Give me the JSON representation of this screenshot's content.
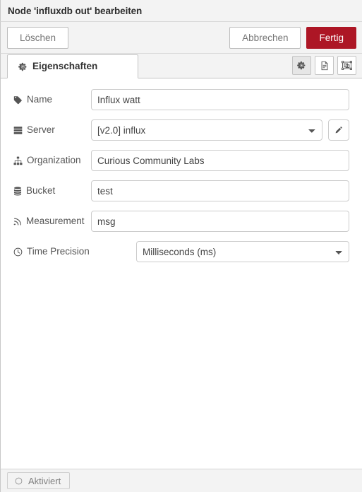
{
  "dialog": {
    "title": "Node 'influxdb out' bearbeiten",
    "buttons": {
      "delete": "Löschen",
      "cancel": "Abbrechen",
      "done": "Fertig"
    },
    "accent_color": "#ad1625"
  },
  "tabs": [
    {
      "label": "Eigenschaften",
      "icon": "gear-icon",
      "active": true
    }
  ],
  "tab_icon_buttons": [
    {
      "name": "properties-icon-button",
      "icon": "gear-icon",
      "active": true
    },
    {
      "name": "description-icon-button",
      "icon": "document-icon",
      "active": false
    },
    {
      "name": "appearance-icon-button",
      "icon": "object-group-icon",
      "active": false
    }
  ],
  "form": {
    "fields": [
      {
        "id": "name",
        "label": "Name",
        "icon": "tag-icon",
        "type": "text",
        "value": "Influx watt",
        "placeholder": "Name"
      },
      {
        "id": "server",
        "label": "Server",
        "icon": "server-icon",
        "type": "select",
        "value": "[v2.0] influx",
        "options": [
          "[v2.0] influx"
        ],
        "has_edit_button": true,
        "edit_icon": "pencil-icon"
      },
      {
        "id": "organization",
        "label": "Organization",
        "icon": "sitemap-icon",
        "type": "text",
        "value": "Curious Community Labs",
        "placeholder": "Organization"
      },
      {
        "id": "bucket",
        "label": "Bucket",
        "icon": "database-icon",
        "type": "text",
        "value": "test",
        "placeholder": "Bucket"
      },
      {
        "id": "measurement",
        "label": "Measurement",
        "icon": "rss-icon",
        "type": "text",
        "value": "msg",
        "placeholder": "Measurement"
      },
      {
        "id": "time_precision",
        "label": "Time Precision",
        "icon": "clock-icon",
        "type": "select",
        "value": "Milliseconds (ms)",
        "options": [
          "Milliseconds (ms)"
        ]
      }
    ]
  },
  "footer": {
    "enabled_toggle": {
      "label": "Aktiviert",
      "icon": "circle-icon"
    }
  }
}
